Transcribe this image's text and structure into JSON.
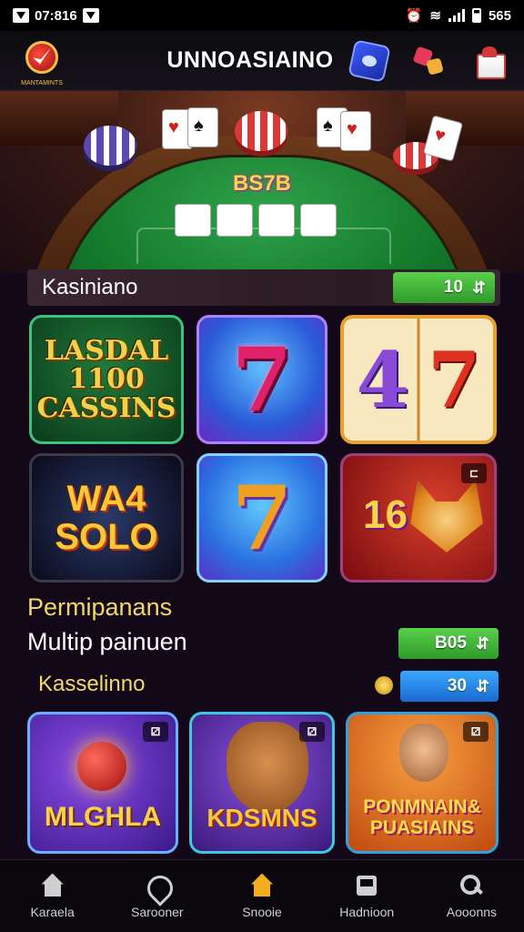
{
  "status_bar": {
    "time": "07:816",
    "right_text": "565"
  },
  "header": {
    "title": "UNNOASIAINO",
    "logo_label": "MANTAMINTS"
  },
  "hero": {
    "table_text": "BS7B"
  },
  "section1": {
    "title": "Kasiniano",
    "pill_value": "10",
    "pill_icon": "arrows-icon"
  },
  "tiles_row1": [
    {
      "name": "tile-lasdal-cassins",
      "text": "LASDAL 1100 CASSINS"
    },
    {
      "name": "tile-seven",
      "text": "7"
    },
    {
      "name": "tile-47",
      "text_a": "4",
      "text_b": "7"
    }
  ],
  "tiles_row2": [
    {
      "name": "tile-wa4-solo",
      "text": "WA4 SOLO"
    },
    {
      "name": "tile-seven-gold",
      "text": "7"
    },
    {
      "name": "tile-16-fox",
      "text": "16",
      "tag": "⊏"
    }
  ],
  "promo": {
    "line1": "Permipanans",
    "line2": "Multip painuen",
    "pill_value": "B05"
  },
  "section2": {
    "title": "Kasselinno",
    "pill_value": "30"
  },
  "tiles_row3": [
    {
      "name": "tile-mlghla",
      "text": "MLGHLA",
      "tag": "⚂"
    },
    {
      "name": "tile-kdsmns",
      "text": "KDSMNS",
      "tag": "⚂"
    },
    {
      "name": "tile-ponmnain",
      "text": "PONMNAIN& PUASIAINS",
      "tag": "⚂"
    }
  ],
  "bottom_nav": [
    {
      "label": "Karaela",
      "icon": "home-icon",
      "active": false
    },
    {
      "label": "Sarooner",
      "icon": "shield-icon",
      "active": false
    },
    {
      "label": "Snooie",
      "icon": "home-icon",
      "active": true
    },
    {
      "label": "Hadnioon",
      "icon": "tray-icon",
      "active": false
    },
    {
      "label": "Aooonns",
      "icon": "search-icon",
      "active": false
    }
  ],
  "colors": {
    "accent_gold": "#f2b020",
    "pill_green": "#2f9a2a",
    "pill_blue": "#1a6ad0",
    "background": "#120818"
  }
}
